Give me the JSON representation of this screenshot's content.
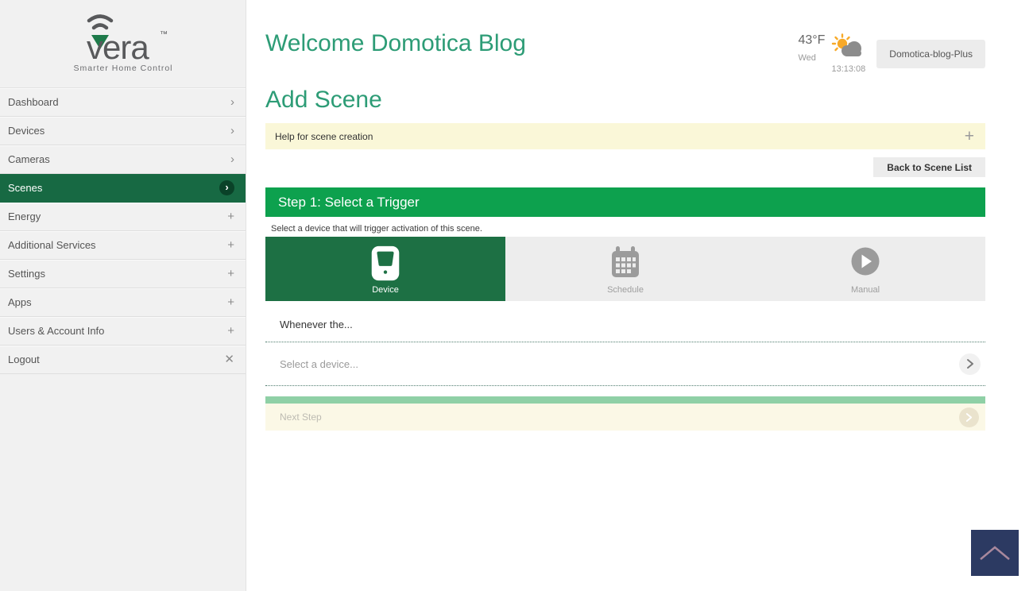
{
  "brand": {
    "name": "vera",
    "trademark": "™",
    "tagline": "Smarter Home Control"
  },
  "sidebar": {
    "items": [
      {
        "label": "Dashboard",
        "icon": "chevron-right-icon",
        "glyph": "›"
      },
      {
        "label": "Devices",
        "icon": "chevron-right-icon",
        "glyph": "›"
      },
      {
        "label": "Cameras",
        "icon": "chevron-right-icon",
        "glyph": "›"
      },
      {
        "label": "Scenes",
        "icon": "chevron-right-circle-icon",
        "glyph": "›",
        "active": true
      },
      {
        "label": "Energy",
        "icon": "plus-icon",
        "glyph": "+"
      },
      {
        "label": "Additional Services",
        "icon": "plus-icon",
        "glyph": "+"
      },
      {
        "label": "Settings",
        "icon": "plus-icon",
        "glyph": "+"
      },
      {
        "label": "Apps",
        "icon": "plus-icon",
        "glyph": "+"
      },
      {
        "label": "Users & Account Info",
        "icon": "plus-icon",
        "glyph": "+"
      },
      {
        "label": "Logout",
        "icon": "close-icon",
        "glyph": "✕"
      }
    ]
  },
  "header": {
    "welcome_title": "Welcome Domotica Blog",
    "weather": {
      "temperature": "43°F",
      "day": "Wed",
      "time": "13:13:08",
      "icon": "partly-cloudy-icon"
    },
    "controller_name": "Domotica-blog-Plus"
  },
  "page": {
    "title": "Add Scene",
    "help_bar": {
      "label": "Help for scene creation",
      "expand_icon": "+"
    },
    "back_button_label": "Back to Scene List",
    "step_header": "Step 1: Select a Trigger",
    "step_description": "Select a device that will trigger activation of this scene.",
    "trigger_tabs": [
      {
        "label": "Device",
        "icon": "device-icon",
        "active": true
      },
      {
        "label": "Schedule",
        "icon": "calendar-icon",
        "active": false
      },
      {
        "label": "Manual",
        "icon": "play-icon",
        "active": false
      }
    ],
    "whenever_label": "Whenever the...",
    "device_select_placeholder": "Select a device...",
    "next_step_label": "Next Step"
  },
  "colors": {
    "accent_green": "#0da14e",
    "active_dark_green": "#1d7044",
    "sidebar_active_green": "#176943",
    "title_teal": "#2d9c76",
    "help_yellow": "#faf7d8",
    "next_step_yellow": "#fbf8e6",
    "light_green_strip": "#8fd0a6",
    "scroll_top_navy": "#2c3a62",
    "sidebar_bg": "#f1f1f1"
  }
}
